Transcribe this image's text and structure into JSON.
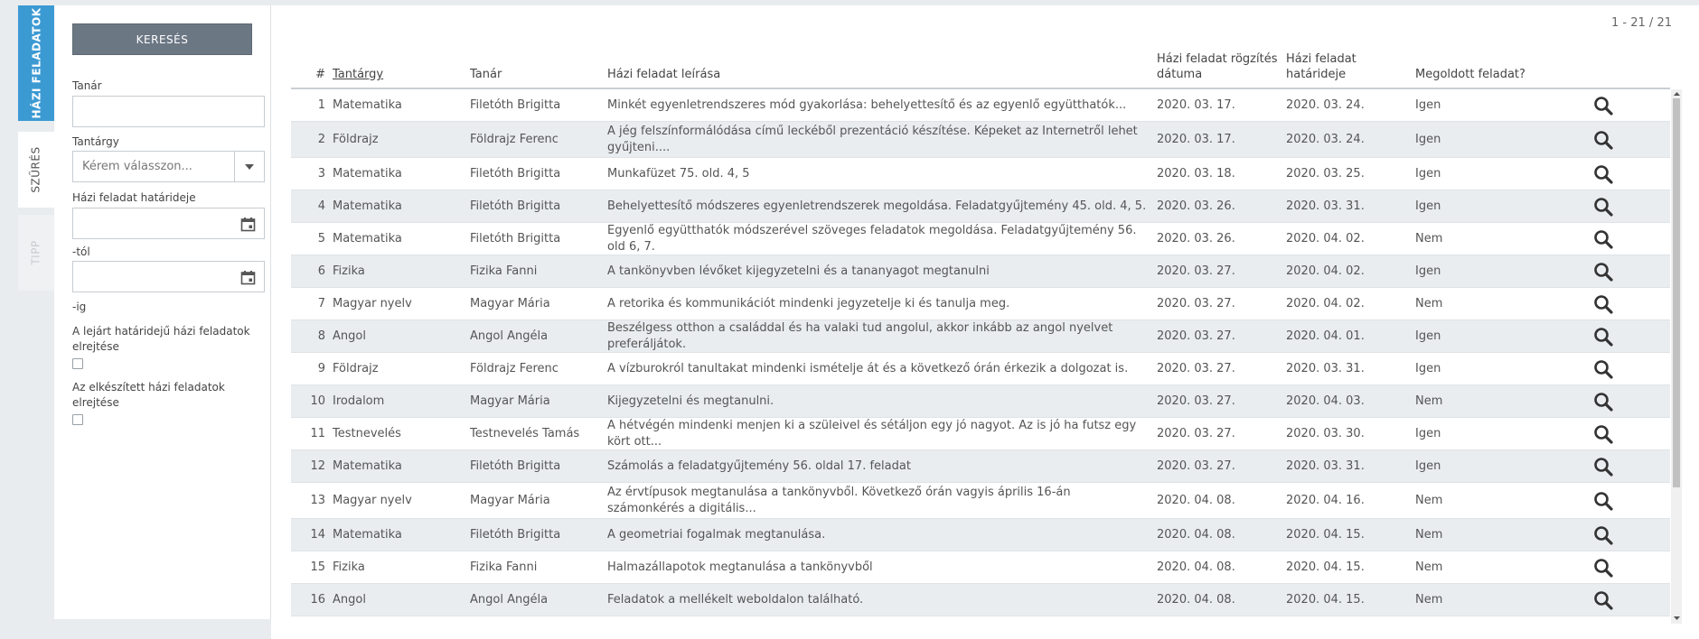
{
  "tabs": {
    "homework": "HÁZI FELADATOK",
    "filter": "SZŰRÉS",
    "tip": "TIPP"
  },
  "filter": {
    "search_button": "KERESÉS",
    "teacher_label": "Tanár",
    "teacher_value": "",
    "subject_label": "Tantárgy",
    "subject_placeholder": "Kérem válasszon...",
    "deadline_label": "Házi feladat határideje",
    "from_label": "-tól",
    "to_label": "-ig",
    "hide_expired_label": "A lejárt határidejű házi feladatok elrejtése",
    "hide_done_label": "Az elkészített házi feladatok elrejtése"
  },
  "pager": "1 - 21 / 21",
  "table": {
    "headers": {
      "num": "#",
      "subject": "Tantárgy",
      "teacher": "Tanár",
      "description": "Házi feladat leírása",
      "recorded": "Házi feladat rögzítés dátuma",
      "deadline": "Házi feladat határideje",
      "solved": "Megoldott feladat?"
    },
    "rows": [
      {
        "num": "1",
        "subject": "Matematika",
        "teacher": "Filetóth Brigitta",
        "description": "Minkét egyenletrendszeres mód gyakorlása: behelyettesítő és az egyenlő együtthatók...",
        "recorded": "2020. 03. 17.",
        "deadline": "2020. 03. 24.",
        "solved": "Igen"
      },
      {
        "num": "2",
        "subject": "Földrajz",
        "teacher": "Földrajz Ferenc",
        "description": "A jég felszínformálódása című leckéből prezentáció készítése. Képeket az Internetről lehet gyűjteni....",
        "recorded": "2020. 03. 17.",
        "deadline": "2020. 03. 24.",
        "solved": "Igen"
      },
      {
        "num": "3",
        "subject": "Matematika",
        "teacher": "Filetóth Brigitta",
        "description": "Munkafüzet 75. old. 4, 5",
        "recorded": "2020. 03. 18.",
        "deadline": "2020. 03. 25.",
        "solved": "Igen"
      },
      {
        "num": "4",
        "subject": "Matematika",
        "teacher": "Filetóth Brigitta",
        "description": "Behelyettesítő módszeres egyenletrendszerek megoldása. Feladatgyűjtemény 45. old. 4, 5.",
        "recorded": "2020. 03. 26.",
        "deadline": "2020. 03. 31.",
        "solved": "Igen"
      },
      {
        "num": "5",
        "subject": "Matematika",
        "teacher": "Filetóth Brigitta",
        "description": "Egyenlő együtthatók módszerével szöveges feladatok megoldása. Feladatgyűjtemény 56. old 6, 7.",
        "recorded": "2020. 03. 26.",
        "deadline": "2020. 04. 02.",
        "solved": "Nem"
      },
      {
        "num": "6",
        "subject": "Fizika",
        "teacher": "Fizika Fanni",
        "description": "A tankönyvben lévőket kijegyzetelni és a tananyagot megtanulni",
        "recorded": "2020. 03. 27.",
        "deadline": "2020. 04. 02.",
        "solved": "Igen"
      },
      {
        "num": "7",
        "subject": "Magyar nyelv",
        "teacher": "Magyar Mária",
        "description": "A retorika és kommunikációt mindenki jegyzetelje ki és tanulja meg.",
        "recorded": "2020. 03. 27.",
        "deadline": "2020. 04. 02.",
        "solved": "Nem"
      },
      {
        "num": "8",
        "subject": "Angol",
        "teacher": "Angol Angéla",
        "description": "Beszélgess otthon a családdal és ha valaki tud angolul, akkor inkább az angol nyelvet preferáljátok.",
        "recorded": "2020. 03. 27.",
        "deadline": "2020. 04. 01.",
        "solved": "Igen"
      },
      {
        "num": "9",
        "subject": "Földrajz",
        "teacher": "Földrajz Ferenc",
        "description": "A vízburokról tanultakat mindenki ismételje át és a következő órán érkezik a dolgozat is.",
        "recorded": "2020. 03. 27.",
        "deadline": "2020. 03. 31.",
        "solved": "Igen"
      },
      {
        "num": "10",
        "subject": "Irodalom",
        "teacher": "Magyar Mária",
        "description": "Kijegyzetelni és megtanulni.",
        "recorded": "2020. 03. 27.",
        "deadline": "2020. 04. 03.",
        "solved": "Nem"
      },
      {
        "num": "11",
        "subject": "Testnevelés",
        "teacher": "Testnevelés Tamás",
        "description": "A hétvégén mindenki menjen ki a szüleivel és sétáljon egy jó nagyot. Az is jó ha futsz egy kört ott...",
        "recorded": "2020. 03. 27.",
        "deadline": "2020. 03. 30.",
        "solved": "Igen"
      },
      {
        "num": "12",
        "subject": "Matematika",
        "teacher": "Filetóth Brigitta",
        "description": "Számolás a feladatgyűjtemény 56. oldal 17. feladat",
        "recorded": "2020. 03. 27.",
        "deadline": "2020. 03. 31.",
        "solved": "Igen"
      },
      {
        "num": "13",
        "subject": "Magyar nyelv",
        "teacher": "Magyar Mária",
        "description": "Az érvtípusok megtanulása a tankönyvből. Következő órán vagyis április 16-án számonkérés a digitális...",
        "recorded": "2020. 04. 08.",
        "deadline": "2020. 04. 16.",
        "solved": "Nem"
      },
      {
        "num": "14",
        "subject": "Matematika",
        "teacher": "Filetóth Brigitta",
        "description": "A geometriai fogalmak megtanulása.",
        "recorded": "2020. 04. 08.",
        "deadline": "2020. 04. 15.",
        "solved": "Nem"
      },
      {
        "num": "15",
        "subject": "Fizika",
        "teacher": "Fizika Fanni",
        "description": "Halmazállapotok megtanulása a tankönyvből",
        "recorded": "2020. 04. 08.",
        "deadline": "2020. 04. 15.",
        "solved": "Nem"
      },
      {
        "num": "16",
        "subject": "Angol",
        "teacher": "Angol Angéla",
        "description": "Feladatok a mellékelt weboldalon található.",
        "recorded": "2020. 04. 08.",
        "deadline": "2020. 04. 15.",
        "solved": "Nem"
      }
    ]
  }
}
